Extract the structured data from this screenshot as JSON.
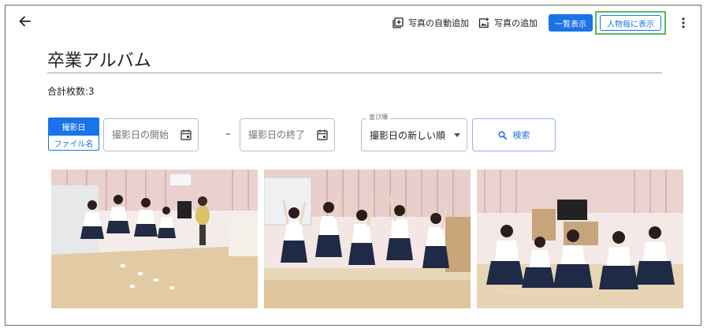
{
  "toolbar": {
    "auto_add_label": "写真の自動追加",
    "add_photo_label": "写真の追加",
    "list_view_label": "一覧表示",
    "person_view_label": "人物毎に表示"
  },
  "page": {
    "title": "卒業アルバム",
    "total": "合計枚数:3"
  },
  "filters": {
    "mode_options": [
      "撮影日",
      "ファイル名"
    ],
    "start_date_placeholder": "撮影日の開始",
    "end_date_placeholder": "撮影日の終了",
    "range_separator": "–",
    "sort_label": "並び順",
    "sort_value": "撮影日の新しい順",
    "search_label": "検索"
  },
  "colors": {
    "accent": "#1a73e8",
    "highlight": "#5cb85c"
  }
}
